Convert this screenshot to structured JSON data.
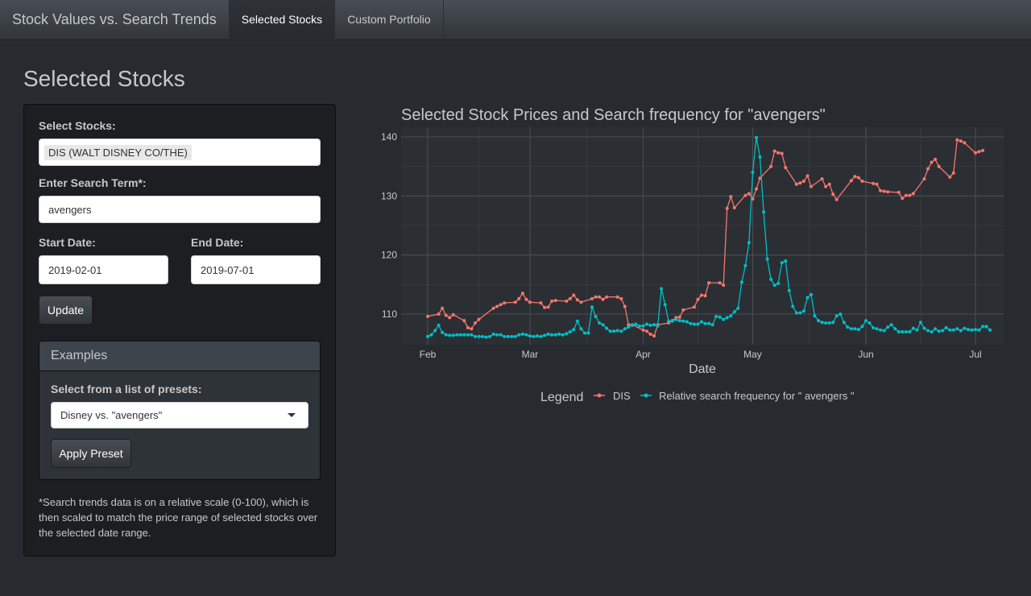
{
  "navbar": {
    "brand": "Stock Values vs. Search Trends",
    "tabs": [
      {
        "label": "Selected Stocks",
        "active": true
      },
      {
        "label": "Custom Portfolio",
        "active": false
      }
    ]
  },
  "page_title": "Selected Stocks",
  "sidebar": {
    "stocks_label": "Select Stocks:",
    "selected_stock": "DIS (WALT DISNEY CO/THE)",
    "search_label": "Enter Search Term*:",
    "search_value": "avengers",
    "start_label": "Start Date:",
    "start_value": "2019-02-01",
    "end_label": "End Date:",
    "end_value": "2019-07-01",
    "update_button": "Update",
    "examples": {
      "title": "Examples",
      "preset_label": "Select from a list of presets:",
      "preset_value": "Disney vs. \"avengers\"",
      "apply_button": "Apply Preset"
    },
    "note": "*Search trends data is on a relative scale (0-100), which is then scaled to match the price range of selected stocks over the selected date range."
  },
  "colors": {
    "background": "#272b30",
    "dis": "#f8766d",
    "search": "#00bfc4"
  },
  "chart_data": {
    "type": "line",
    "title": "Selected Stock Prices and Search frequency for \"avengers\"",
    "xlabel": "Date",
    "ylabel": "",
    "x_ticks": [
      "Feb",
      "Mar",
      "Apr",
      "May",
      "Jun",
      "Jul"
    ],
    "y_ticks": [
      110,
      120,
      130,
      140
    ],
    "xlim": [
      "2019-02-01",
      "2019-07-01"
    ],
    "ylim": [
      105,
      141
    ],
    "grid": true,
    "legend": {
      "title": "Legend",
      "position": "bottom"
    },
    "series": [
      {
        "name": "DIS",
        "color": "#f8766d",
        "points": [
          [
            "2019-02-01",
            109.6
          ],
          [
            "2019-02-04",
            110
          ],
          [
            "2019-02-05",
            111
          ],
          [
            "2019-02-06",
            109.8
          ],
          [
            "2019-02-07",
            109.4
          ],
          [
            "2019-02-08",
            109.9
          ],
          [
            "2019-02-11",
            108.9
          ],
          [
            "2019-02-12",
            107.7
          ],
          [
            "2019-02-13",
            107.5
          ],
          [
            "2019-02-14",
            108.5
          ],
          [
            "2019-02-15",
            109.1
          ],
          [
            "2019-02-19",
            111
          ],
          [
            "2019-02-20",
            111.3
          ],
          [
            "2019-02-21",
            111.6
          ],
          [
            "2019-02-22",
            111.9
          ],
          [
            "2019-02-25",
            112
          ],
          [
            "2019-02-26",
            112.6
          ],
          [
            "2019-02-27",
            113.5
          ],
          [
            "2019-02-28",
            112.5
          ],
          [
            "2019-03-01",
            112
          ],
          [
            "2019-03-04",
            111.9
          ],
          [
            "2019-03-05",
            111.1
          ],
          [
            "2019-03-06",
            111.2
          ],
          [
            "2019-03-07",
            112.2
          ],
          [
            "2019-03-08",
            112.3
          ],
          [
            "2019-03-11",
            112.2
          ],
          [
            "2019-03-12",
            112.6
          ],
          [
            "2019-03-13",
            113.2
          ],
          [
            "2019-03-14",
            112.4
          ],
          [
            "2019-03-15",
            112
          ],
          [
            "2019-03-18",
            112.6
          ],
          [
            "2019-03-19",
            112.9
          ],
          [
            "2019-03-20",
            112.9
          ],
          [
            "2019-03-21",
            112.5
          ],
          [
            "2019-03-22",
            112.9
          ],
          [
            "2019-03-25",
            112.9
          ],
          [
            "2019-03-26",
            112.6
          ],
          [
            "2019-03-27",
            111.3
          ],
          [
            "2019-03-28",
            108.2
          ],
          [
            "2019-03-29",
            108.2
          ],
          [
            "2019-04-01",
            107.3
          ],
          [
            "2019-04-02",
            107.1
          ],
          [
            "2019-04-03",
            106.6
          ],
          [
            "2019-04-04",
            106.3
          ],
          [
            "2019-04-05",
            108.2
          ],
          [
            "2019-04-08",
            108.5
          ],
          [
            "2019-04-09",
            108.9
          ],
          [
            "2019-04-10",
            109.4
          ],
          [
            "2019-04-11",
            109.5
          ],
          [
            "2019-04-12",
            110.7
          ],
          [
            "2019-04-15",
            111.2
          ],
          [
            "2019-04-16",
            112.5
          ],
          [
            "2019-04-17",
            113.2
          ],
          [
            "2019-04-18",
            113.1
          ],
          [
            "2019-04-19",
            115.3
          ],
          [
            "2019-04-22",
            115.3
          ],
          [
            "2019-04-23",
            114.9
          ],
          [
            "2019-04-24",
            127.9
          ],
          [
            "2019-04-25",
            129.9
          ],
          [
            "2019-04-26",
            128
          ],
          [
            "2019-04-29",
            130.1
          ],
          [
            "2019-04-30",
            130.4
          ],
          [
            "2019-05-01",
            129.5
          ],
          [
            "2019-05-02",
            131.2
          ],
          [
            "2019-05-03",
            133
          ],
          [
            "2019-05-06",
            135
          ],
          [
            "2019-05-07",
            137.6
          ],
          [
            "2019-05-08",
            137.3
          ],
          [
            "2019-05-09",
            137.2
          ],
          [
            "2019-05-10",
            134.8
          ],
          [
            "2019-05-13",
            132
          ],
          [
            "2019-05-14",
            132.2
          ],
          [
            "2019-05-15",
            132.5
          ],
          [
            "2019-05-16",
            133.4
          ],
          [
            "2019-05-17",
            131.6
          ],
          [
            "2019-05-20",
            132.9
          ],
          [
            "2019-05-21",
            131.6
          ],
          [
            "2019-05-22",
            132
          ],
          [
            "2019-05-23",
            130.3
          ],
          [
            "2019-05-24",
            129.4
          ],
          [
            "2019-05-28",
            132.6
          ],
          [
            "2019-05-29",
            133.3
          ],
          [
            "2019-05-30",
            133.1
          ],
          [
            "2019-05-31",
            132.5
          ],
          [
            "2019-06-03",
            132.1
          ],
          [
            "2019-06-04",
            132
          ],
          [
            "2019-06-05",
            130.9
          ],
          [
            "2019-06-06",
            130.8
          ],
          [
            "2019-06-07",
            130.7
          ],
          [
            "2019-06-10",
            130.6
          ],
          [
            "2019-06-11",
            129.6
          ],
          [
            "2019-06-12",
            130.1
          ],
          [
            "2019-06-13",
            130.1
          ],
          [
            "2019-06-14",
            130.4
          ],
          [
            "2019-06-17",
            132.9
          ],
          [
            "2019-06-18",
            134.6
          ],
          [
            "2019-06-19",
            135.7
          ],
          [
            "2019-06-20",
            136.2
          ],
          [
            "2019-06-21",
            135
          ],
          [
            "2019-06-24",
            133.2
          ],
          [
            "2019-06-25",
            133.9
          ],
          [
            "2019-06-26",
            139.5
          ],
          [
            "2019-06-27",
            139.3
          ],
          [
            "2019-06-28",
            139
          ],
          [
            "2019-07-01",
            137.3
          ],
          [
            "2019-07-02",
            137.5
          ],
          [
            "2019-07-03",
            137.7
          ]
        ]
      },
      {
        "name": "Relative search frequency for \" avengers \"",
        "color": "#00bfc4",
        "points": [
          [
            "2019-02-01",
            106.2
          ],
          [
            "2019-02-02",
            106.5
          ],
          [
            "2019-02-03",
            107.2
          ],
          [
            "2019-02-04",
            108.1
          ],
          [
            "2019-02-05",
            106.9
          ],
          [
            "2019-02-06",
            106.5
          ],
          [
            "2019-02-07",
            106.4
          ],
          [
            "2019-02-08",
            106.4
          ],
          [
            "2019-02-09",
            106.5
          ],
          [
            "2019-02-10",
            106.5
          ],
          [
            "2019-02-11",
            106.5
          ],
          [
            "2019-02-12",
            106.5
          ],
          [
            "2019-02-13",
            106.5
          ],
          [
            "2019-02-14",
            106.2
          ],
          [
            "2019-02-15",
            106.2
          ],
          [
            "2019-02-16",
            106.2
          ],
          [
            "2019-02-17",
            106.1
          ],
          [
            "2019-02-18",
            106.2
          ],
          [
            "2019-02-19",
            106.6
          ],
          [
            "2019-02-20",
            106.5
          ],
          [
            "2019-02-21",
            106.5
          ],
          [
            "2019-02-22",
            106.2
          ],
          [
            "2019-02-23",
            106.2
          ],
          [
            "2019-02-24",
            106.2
          ],
          [
            "2019-02-25",
            106.2
          ],
          [
            "2019-02-26",
            106.5
          ],
          [
            "2019-02-27",
            106.6
          ],
          [
            "2019-02-28",
            106.5
          ],
          [
            "2019-03-01",
            106.3
          ],
          [
            "2019-03-02",
            106.2
          ],
          [
            "2019-03-03",
            106.3
          ],
          [
            "2019-03-04",
            106.2
          ],
          [
            "2019-03-05",
            106.4
          ],
          [
            "2019-03-06",
            106.6
          ],
          [
            "2019-03-07",
            106.5
          ],
          [
            "2019-03-08",
            106.5
          ],
          [
            "2019-03-09",
            106.6
          ],
          [
            "2019-03-10",
            106.5
          ],
          [
            "2019-03-11",
            106.7
          ],
          [
            "2019-03-12",
            107
          ],
          [
            "2019-03-13",
            107.4
          ],
          [
            "2019-03-14",
            108.8
          ],
          [
            "2019-03-15",
            107.5
          ],
          [
            "2019-03-16",
            106.8
          ],
          [
            "2019-03-17",
            106.8
          ],
          [
            "2019-03-18",
            111.2
          ],
          [
            "2019-03-19",
            109.6
          ],
          [
            "2019-03-20",
            108.5
          ],
          [
            "2019-03-21",
            108.2
          ],
          [
            "2019-03-22",
            107.6
          ],
          [
            "2019-03-23",
            107.1
          ],
          [
            "2019-03-24",
            107.1
          ],
          [
            "2019-03-25",
            107.2
          ],
          [
            "2019-03-26",
            107.1
          ],
          [
            "2019-03-27",
            107.5
          ],
          [
            "2019-03-28",
            107.8
          ],
          [
            "2019-03-29",
            108.1
          ],
          [
            "2019-03-30",
            108.3
          ],
          [
            "2019-03-31",
            108
          ],
          [
            "2019-04-01",
            108
          ],
          [
            "2019-04-02",
            108.3
          ],
          [
            "2019-04-03",
            108.1
          ],
          [
            "2019-04-04",
            108.2
          ],
          [
            "2019-04-05",
            108
          ],
          [
            "2019-04-06",
            114.3
          ],
          [
            "2019-04-07",
            111.6
          ],
          [
            "2019-04-08",
            108.8
          ],
          [
            "2019-04-09",
            108.8
          ],
          [
            "2019-04-10",
            109.1
          ],
          [
            "2019-04-11",
            108.9
          ],
          [
            "2019-04-12",
            108.8
          ],
          [
            "2019-04-13",
            108.7
          ],
          [
            "2019-04-14",
            108.4
          ],
          [
            "2019-04-15",
            108.3
          ],
          [
            "2019-04-16",
            108.3
          ],
          [
            "2019-04-17",
            108.7
          ],
          [
            "2019-04-18",
            108.4
          ],
          [
            "2019-04-19",
            108.4
          ],
          [
            "2019-04-20",
            108.2
          ],
          [
            "2019-04-21",
            109.6
          ],
          [
            "2019-04-22",
            109.5
          ],
          [
            "2019-04-23",
            109.1
          ],
          [
            "2019-04-24",
            109.4
          ],
          [
            "2019-04-25",
            109.7
          ],
          [
            "2019-04-26",
            110.4
          ],
          [
            "2019-04-27",
            111
          ],
          [
            "2019-04-28",
            115.4
          ],
          [
            "2019-04-29",
            118.2
          ],
          [
            "2019-04-30",
            122.1
          ],
          [
            "2019-05-01",
            134
          ],
          [
            "2019-05-02",
            139.9
          ],
          [
            "2019-05-03",
            136.6
          ],
          [
            "2019-05-04",
            127.3
          ],
          [
            "2019-05-05",
            119.3
          ],
          [
            "2019-05-06",
            115.9
          ],
          [
            "2019-05-07",
            114.9
          ],
          [
            "2019-05-08",
            115.2
          ],
          [
            "2019-05-09",
            118.7
          ],
          [
            "2019-05-10",
            119
          ],
          [
            "2019-05-11",
            114
          ],
          [
            "2019-05-12",
            111.3
          ],
          [
            "2019-05-13",
            110.2
          ],
          [
            "2019-05-14",
            110.2
          ],
          [
            "2019-05-15",
            110.5
          ],
          [
            "2019-05-16",
            112.8
          ],
          [
            "2019-05-17",
            113.3
          ],
          [
            "2019-05-18",
            109.7
          ],
          [
            "2019-05-19",
            108.9
          ],
          [
            "2019-05-20",
            108.6
          ],
          [
            "2019-05-21",
            108.5
          ],
          [
            "2019-05-22",
            108.5
          ],
          [
            "2019-05-23",
            108.6
          ],
          [
            "2019-05-24",
            109.7
          ],
          [
            "2019-05-25",
            110
          ],
          [
            "2019-05-26",
            108.6
          ],
          [
            "2019-05-27",
            107.8
          ],
          [
            "2019-05-28",
            107.5
          ],
          [
            "2019-05-29",
            107.5
          ],
          [
            "2019-05-30",
            107.4
          ],
          [
            "2019-05-31",
            107.9
          ],
          [
            "2019-06-01",
            108.9
          ],
          [
            "2019-06-02",
            108.5
          ],
          [
            "2019-06-03",
            107.7
          ],
          [
            "2019-06-04",
            107.5
          ],
          [
            "2019-06-05",
            107.3
          ],
          [
            "2019-06-06",
            107.2
          ],
          [
            "2019-06-07",
            107.8
          ],
          [
            "2019-06-08",
            108.2
          ],
          [
            "2019-06-09",
            107.5
          ],
          [
            "2019-06-10",
            107
          ],
          [
            "2019-06-11",
            107
          ],
          [
            "2019-06-12",
            107
          ],
          [
            "2019-06-13",
            107
          ],
          [
            "2019-06-14",
            107.6
          ],
          [
            "2019-06-15",
            107.3
          ],
          [
            "2019-06-16",
            108.6
          ],
          [
            "2019-06-17",
            107.6
          ],
          [
            "2019-06-18",
            107.2
          ],
          [
            "2019-06-19",
            107
          ],
          [
            "2019-06-20",
            107.5
          ],
          [
            "2019-06-21",
            107.1
          ],
          [
            "2019-06-22",
            107.2
          ],
          [
            "2019-06-23",
            107.7
          ],
          [
            "2019-06-24",
            107.3
          ],
          [
            "2019-06-25",
            107.3
          ],
          [
            "2019-06-26",
            107.5
          ],
          [
            "2019-06-27",
            107.2
          ],
          [
            "2019-06-28",
            107.6
          ],
          [
            "2019-06-29",
            107.4
          ],
          [
            "2019-06-30",
            107.3
          ],
          [
            "2019-07-01",
            107.4
          ],
          [
            "2019-07-02",
            107.3
          ],
          [
            "2019-07-03",
            107.9
          ],
          [
            "2019-07-04",
            107.9
          ],
          [
            "2019-07-05",
            107.3
          ]
        ]
      }
    ]
  }
}
